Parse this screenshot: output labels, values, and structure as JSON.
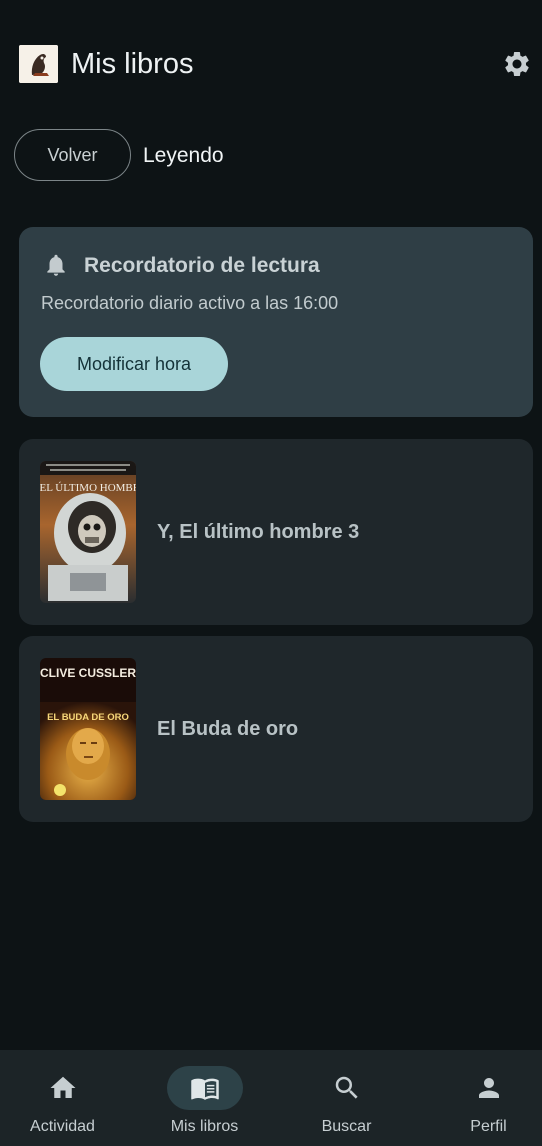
{
  "header": {
    "title": "Mis libros",
    "settings_icon": "gear-icon"
  },
  "filter": {
    "back_label": "Volver",
    "current_label": "Leyendo"
  },
  "reminder": {
    "title": "Recordatorio de lectura",
    "text": "Recordatorio diario activo a las 16:00",
    "button_label": "Modificar hora",
    "icon": "bell-icon"
  },
  "books": [
    {
      "title": "Y, El último hombre 3",
      "cover_text_1": "Y EL ÚLTIMO HOMBRE",
      "cover_text_2": ""
    },
    {
      "title": "El Buda de oro",
      "cover_text_1": "CLIVE CUSSLER",
      "cover_text_2": "EL BUDA DE ORO"
    }
  ],
  "nav": {
    "items": [
      {
        "label": "Actividad",
        "icon": "home-icon"
      },
      {
        "label": "Mis libros",
        "icon": "book-icon",
        "active": true
      },
      {
        "label": "Buscar",
        "icon": "search-icon"
      },
      {
        "label": "Perfil",
        "icon": "person-icon"
      }
    ]
  },
  "colors": {
    "background": "#0d1315",
    "reminder_card": "#2f3e45",
    "book_card": "#1f272b",
    "accent_button": "#a9d5d9",
    "nav_bar": "#1c2427"
  }
}
